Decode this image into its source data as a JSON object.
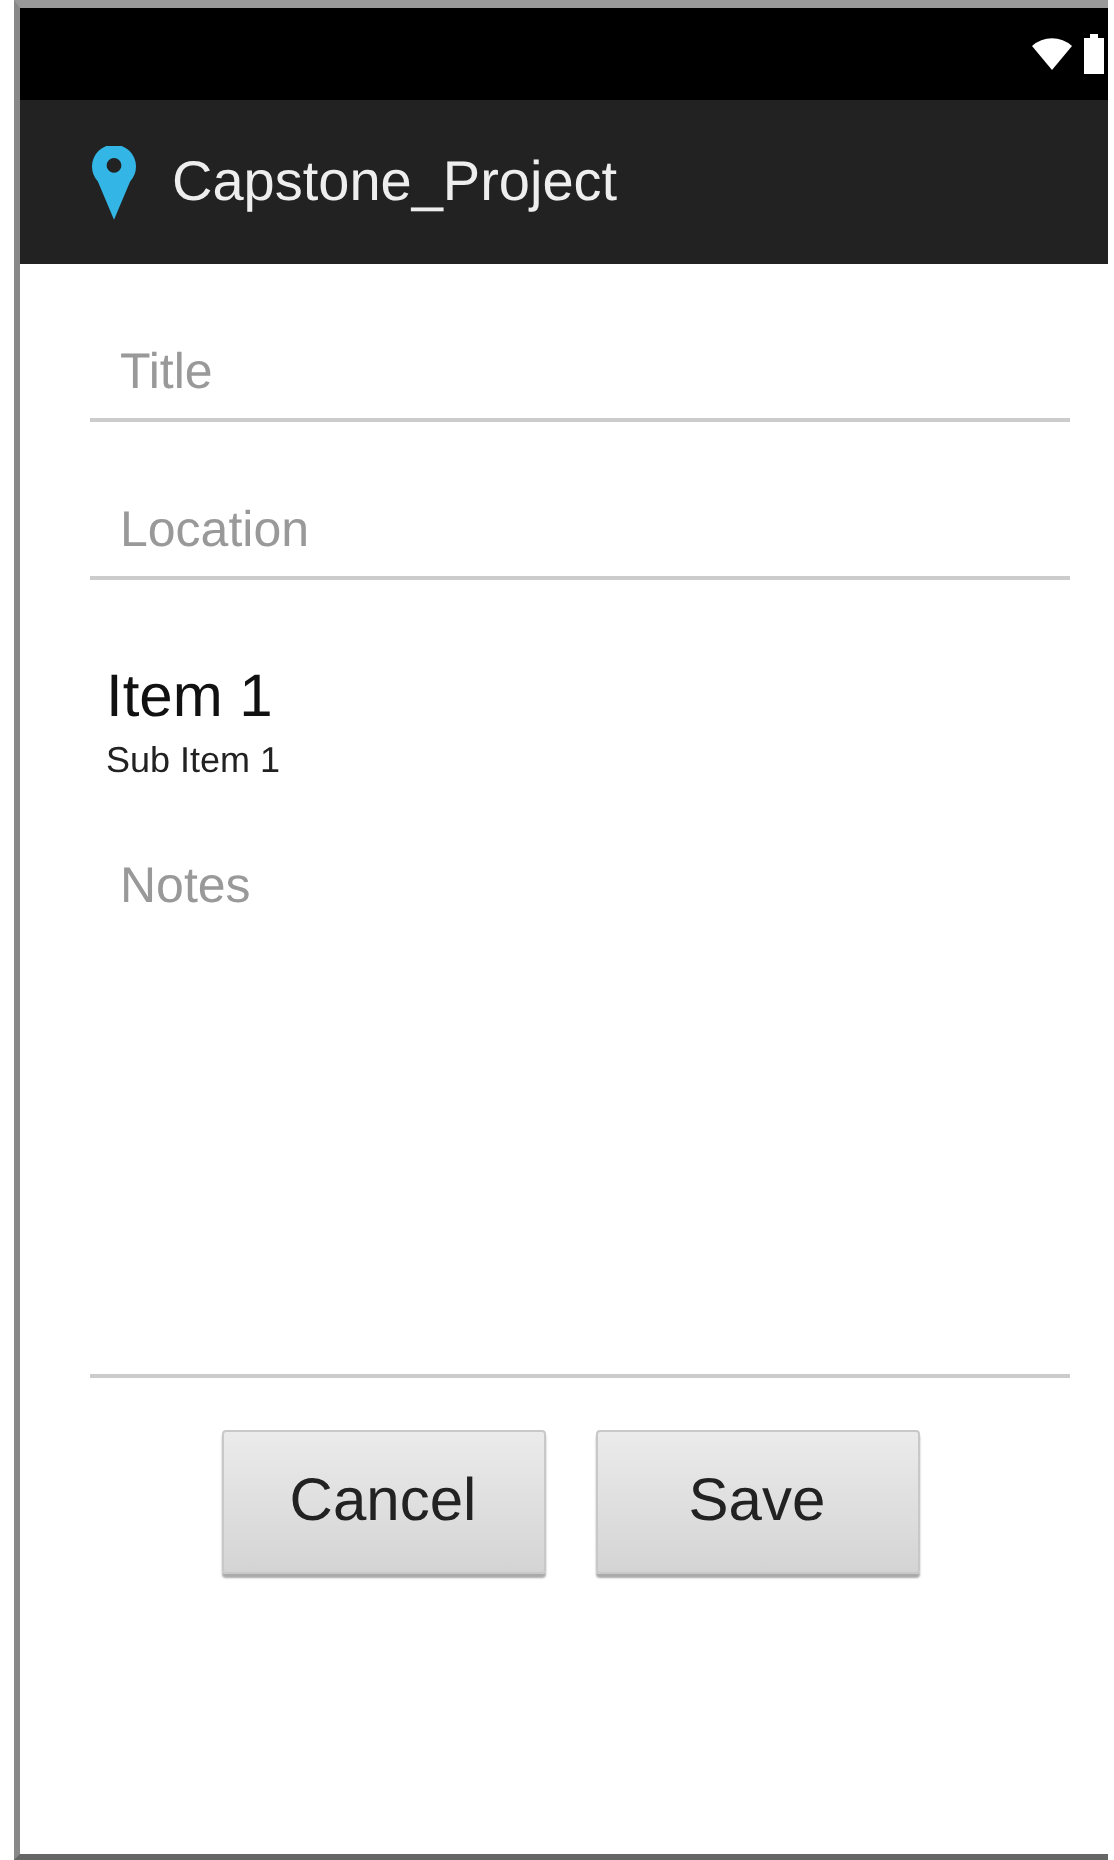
{
  "app_bar": {
    "title": "Capstone_Project"
  },
  "fields": [
    {
      "placeholder": "Title"
    },
    {
      "placeholder": "Location"
    }
  ],
  "list_item": {
    "title": "Item 1",
    "subtitle": "Sub Item 1"
  },
  "notes": {
    "placeholder": "Notes"
  },
  "buttons": [
    "Cancel",
    "Save"
  ]
}
